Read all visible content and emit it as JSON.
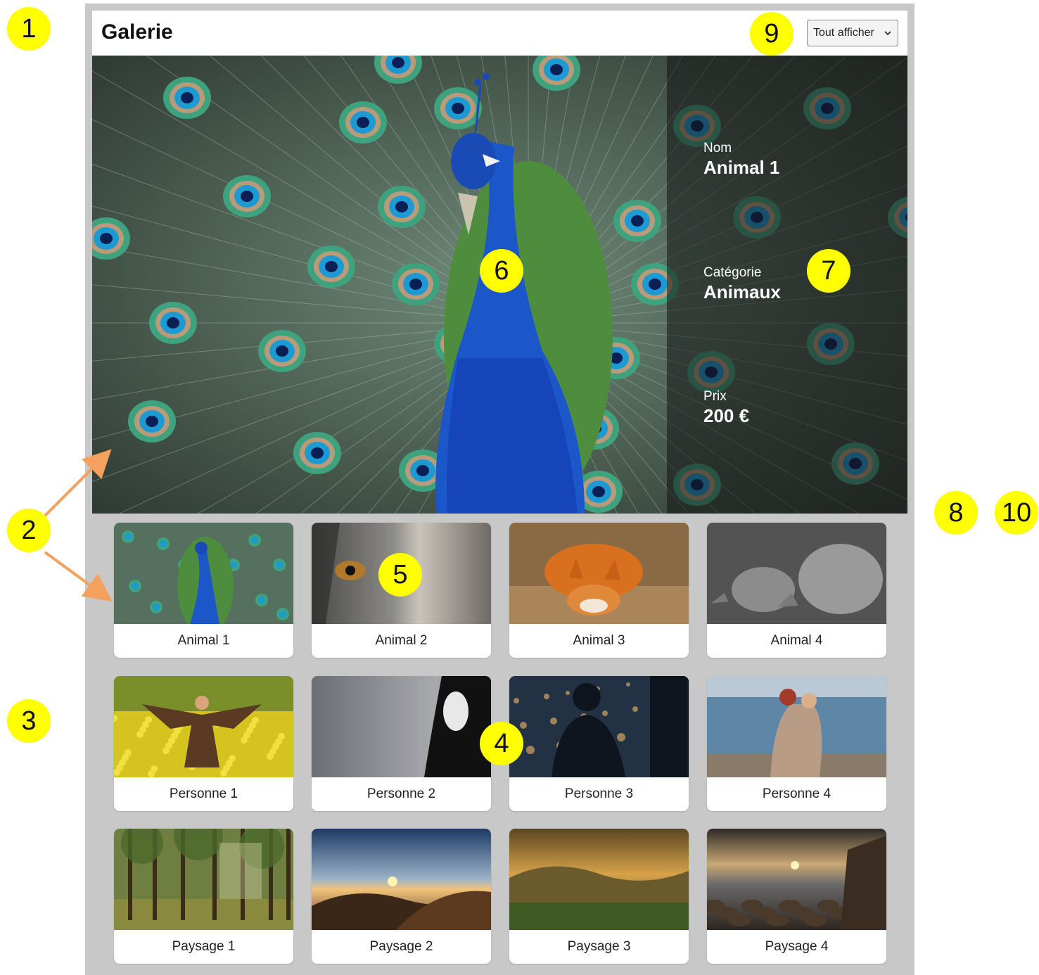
{
  "app": {
    "title": "Galerie"
  },
  "filter": {
    "selected": "Tout afficher"
  },
  "details": {
    "name_label": "Nom",
    "name_value": "Animal 1",
    "category_label": "Catégorie",
    "category_value": "Animaux",
    "price_label": "Prix",
    "price_value": "200 €"
  },
  "gallery": [
    {
      "caption": "Animal 1",
      "image": "peacock"
    },
    {
      "caption": "Animal 2",
      "image": "wolf-eye"
    },
    {
      "caption": "Animal 3",
      "image": "fox"
    },
    {
      "caption": "Animal 4",
      "image": "rhinos"
    },
    {
      "caption": "Personne 1",
      "image": "woman-in-flowers"
    },
    {
      "caption": "Personne 2",
      "image": "woman-portrait"
    },
    {
      "caption": "Personne 3",
      "image": "silhouette-bokeh"
    },
    {
      "caption": "Personne 4",
      "image": "couple-by-sea"
    },
    {
      "caption": "Paysage 1",
      "image": "forest"
    },
    {
      "caption": "Paysage 2",
      "image": "mountain-sunset"
    },
    {
      "caption": "Paysage 3",
      "image": "valley"
    },
    {
      "caption": "Paysage 4",
      "image": "rocky-shore"
    }
  ],
  "annotations": [
    "1",
    "2",
    "3",
    "4",
    "5",
    "6",
    "7",
    "8",
    "9",
    "10"
  ],
  "colors": {
    "badge": "#ffff00",
    "arrow": "#f4a15d",
    "frame": "#c8c8c8",
    "accent": "#1f6fd0"
  }
}
